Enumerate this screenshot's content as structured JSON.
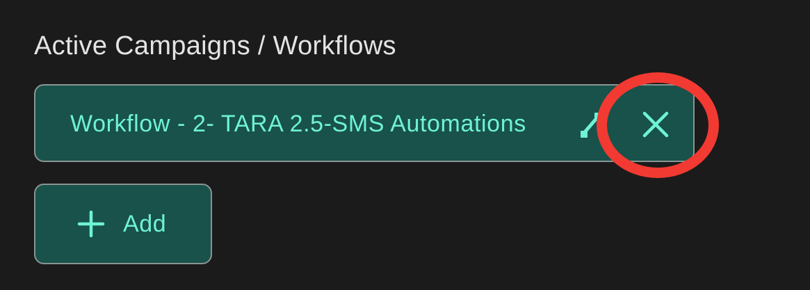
{
  "section": {
    "title": "Active Campaigns / Workflows"
  },
  "workflow_chip": {
    "label": "Workflow - 2- TARA 2.5-SMS Automations",
    "icon": "workflow-icon",
    "remove_icon": "close-icon"
  },
  "add_button": {
    "label": "Add",
    "icon": "plus-icon"
  },
  "colors": {
    "background": "#1b1b1b",
    "chip_fill": "#18524a",
    "accent_text": "#6ff2d6",
    "border": "#8a9592",
    "highlight": "#f23a32"
  }
}
